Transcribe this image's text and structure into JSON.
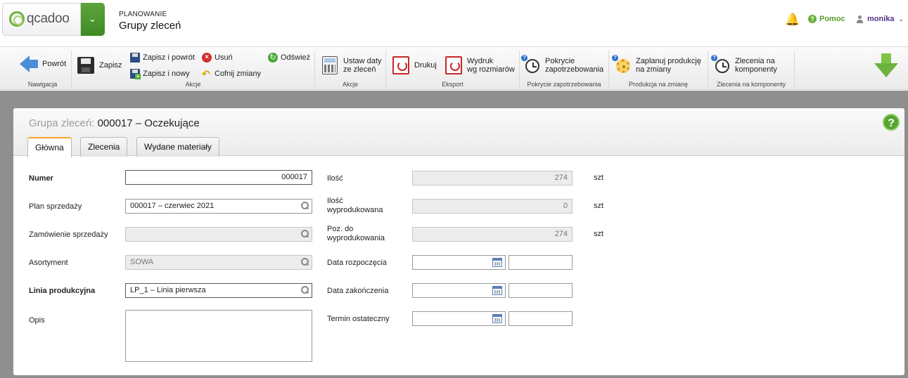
{
  "header": {
    "logo_text": "qcadoo",
    "category": "PLANOWANIE",
    "title": "Grupy zleceń",
    "help": "Pomoc",
    "user": "monika"
  },
  "ribbon": {
    "groups": [
      {
        "label": "Nawigacja"
      },
      {
        "label": "Akcje"
      },
      {
        "label": "Akcje"
      },
      {
        "label": "Eksport"
      },
      {
        "label": "Pokrycie zapotrzebowania"
      },
      {
        "label": "Produkcja na zmianę"
      },
      {
        "label": "Zlecenia na komponenty"
      }
    ],
    "back": "Powrót",
    "save": "Zapisz",
    "save_back": "Zapisz i powrót",
    "save_new": "Zapisz i nowy",
    "delete": "Usuń",
    "undo": "Cofnij zmiany",
    "refresh": "Odśwież",
    "set_dates_1": "Ustaw daty",
    "set_dates_2": "ze zleceń",
    "print": "Drukuj",
    "print_sizes_1": "Wydruk",
    "print_sizes_2": "wg rozmiarów",
    "coverage_1": "Pokrycie",
    "coverage_2": "zapotrzebowania",
    "shift_1": "Zaplanuj produkcję",
    "shift_2": "na zmiany",
    "components_1": "Zlecenia na",
    "components_2": "komponenty"
  },
  "panel": {
    "title_prefix": "Grupa zleceń:",
    "title_value": "000017 – Oczekujące",
    "tabs": [
      "Główna",
      "Zlecenia",
      "Wydane materiały"
    ]
  },
  "form": {
    "numer_label": "Numer",
    "numer_value": "000017",
    "plan_label": "Plan sprzedaży",
    "plan_value": "000017 – czerwiec 2021",
    "zamowienie_label": "Zamówienie sprzedaży",
    "zamowienie_value": "",
    "asortyment_label": "Asortyment",
    "asortyment_value": "SOWA",
    "linia_label": "Linia produkcyjna",
    "linia_value": "LP_1 – Linia pierwsza",
    "opis_label": "Opis",
    "opis_value": "",
    "ilosc_label": "Ilość",
    "ilosc_value": "274",
    "wyprodukowana_label_1": "Ilość",
    "wyprodukowana_label_2": "wyprodukowana",
    "wyprodukowana_value": "0",
    "do_wypr_label_1": "Poz. do",
    "do_wypr_label_2": "wyprodukowania",
    "do_wypr_value": "274",
    "unit": "szt",
    "data_rozp_label": "Data rozpoczęcia",
    "data_zak_label": "Data zakończenia",
    "termin_label": "Termin ostateczny"
  },
  "colors": {
    "accent_green": "#6cb33f",
    "tab_active": "#f5a623",
    "user_purple": "#553388",
    "backdrop": "#8f8f8f"
  }
}
